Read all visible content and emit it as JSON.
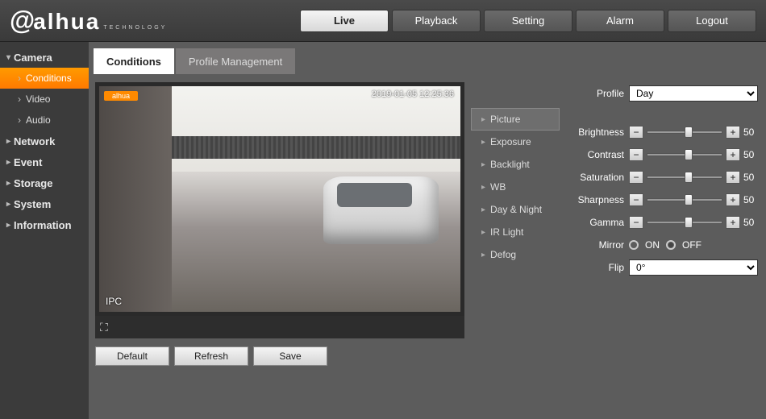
{
  "brand": {
    "name": "alhua",
    "sub": "TECHNOLOGY"
  },
  "topnav": {
    "live": "Live",
    "playback": "Playback",
    "setting": "Setting",
    "alarm": "Alarm",
    "logout": "Logout"
  },
  "sidebar": {
    "camera": "Camera",
    "conditions": "Conditions",
    "video": "Video",
    "audio": "Audio",
    "network": "Network",
    "event": "Event",
    "storage": "Storage",
    "system": "System",
    "information": "Information"
  },
  "tabs": {
    "conditions": "Conditions",
    "profile": "Profile Management"
  },
  "osd": {
    "badge": "alhua",
    "timestamp": "2019-01-05 12:25:36",
    "ipc": "IPC"
  },
  "buttons": {
    "default": "Default",
    "refresh": "Refresh",
    "save": "Save"
  },
  "subnav": {
    "picture": "Picture",
    "exposure": "Exposure",
    "backlight": "Backlight",
    "wb": "WB",
    "daynight": "Day & Night",
    "irlight": "IR Light",
    "defog": "Defog"
  },
  "settings": {
    "profile_label": "Profile",
    "profile_value": "Day",
    "brightness_label": "Brightness",
    "brightness_value": "50",
    "contrast_label": "Contrast",
    "contrast_value": "50",
    "saturation_label": "Saturation",
    "saturation_value": "50",
    "sharpness_label": "Sharpness",
    "sharpness_value": "50",
    "gamma_label": "Gamma",
    "gamma_value": "50",
    "mirror_label": "Mirror",
    "mirror_on": "ON",
    "mirror_off": "OFF",
    "flip_label": "Flip",
    "flip_value": "0°"
  }
}
